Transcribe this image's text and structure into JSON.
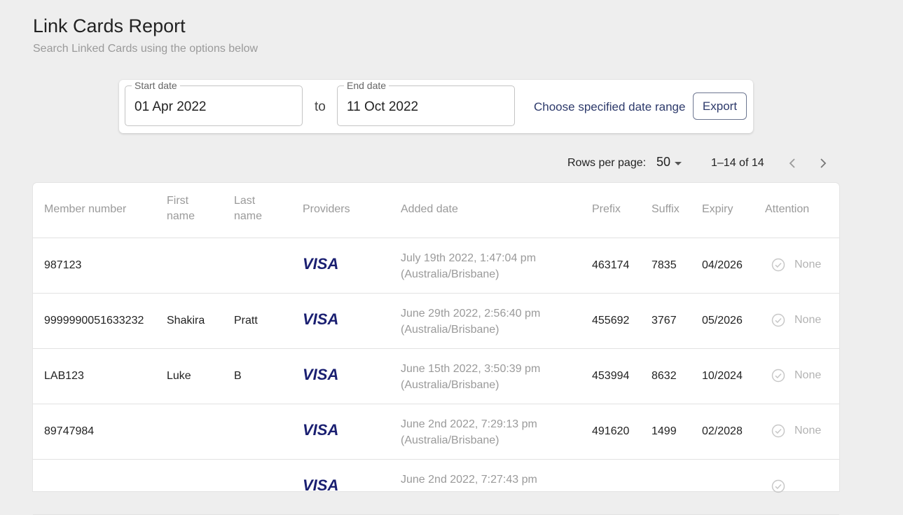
{
  "header": {
    "title": "Link Cards Report",
    "subtitle": "Search Linked Cards using the options below"
  },
  "filters": {
    "start_label": "Start date",
    "start_value": "01 Apr 2022",
    "to_label": "to",
    "end_label": "End date",
    "end_value": "11 Oct 2022",
    "range_link": "Choose specified date range",
    "export_label": "Export"
  },
  "pagination": {
    "rows_per_page_label": "Rows per page:",
    "rows_per_page_value": "50",
    "range": "1–14 of 14"
  },
  "table": {
    "columns": {
      "member_number": "Member number",
      "first_name_1": "First",
      "first_name_2": "name",
      "last_name_1": "Last",
      "last_name_2": "name",
      "providers": "Providers",
      "added_date": "Added date",
      "prefix": "Prefix",
      "suffix": "Suffix",
      "expiry": "Expiry",
      "attention": "Attention"
    },
    "rows": [
      {
        "member": "987123",
        "first": "",
        "last": "",
        "provider": "VISA",
        "date_line1": "July 19th 2022, 1:47:04 pm",
        "date_line2": "(Australia/Brisbane)",
        "prefix": "463174",
        "suffix": "7835",
        "expiry": "04/2026",
        "attention": "None"
      },
      {
        "member": "9999990051633232",
        "first": "Shakira",
        "last": "Pratt",
        "provider": "VISA",
        "date_line1": "June 29th 2022, 2:56:40 pm",
        "date_line2": "(Australia/Brisbane)",
        "prefix": "455692",
        "suffix": "3767",
        "expiry": "05/2026",
        "attention": "None"
      },
      {
        "member": "LAB123",
        "first": "Luke",
        "last": "B",
        "provider": "VISA",
        "date_line1": "June 15th 2022, 3:50:39 pm",
        "date_line2": "(Australia/Brisbane)",
        "prefix": "453994",
        "suffix": "8632",
        "expiry": "10/2024",
        "attention": "None"
      },
      {
        "member": "89747984",
        "first": "",
        "last": "",
        "provider": "VISA",
        "date_line1": "June 2nd 2022, 7:29:13 pm",
        "date_line2": "(Australia/Brisbane)",
        "prefix": "491620",
        "suffix": "1499",
        "expiry": "02/2028",
        "attention": "None"
      },
      {
        "member": "",
        "first": "",
        "last": "",
        "provider": "VISA",
        "date_line1": "June 2nd 2022, 7:27:43 pm",
        "date_line2": "",
        "prefix": "",
        "suffix": "",
        "expiry": "",
        "attention": ""
      }
    ]
  },
  "colors": {
    "background": "#eeeeee",
    "visa_blue": "#1a1f71",
    "link": "#2d3a6b",
    "muted_text": "#9a9a9a"
  }
}
